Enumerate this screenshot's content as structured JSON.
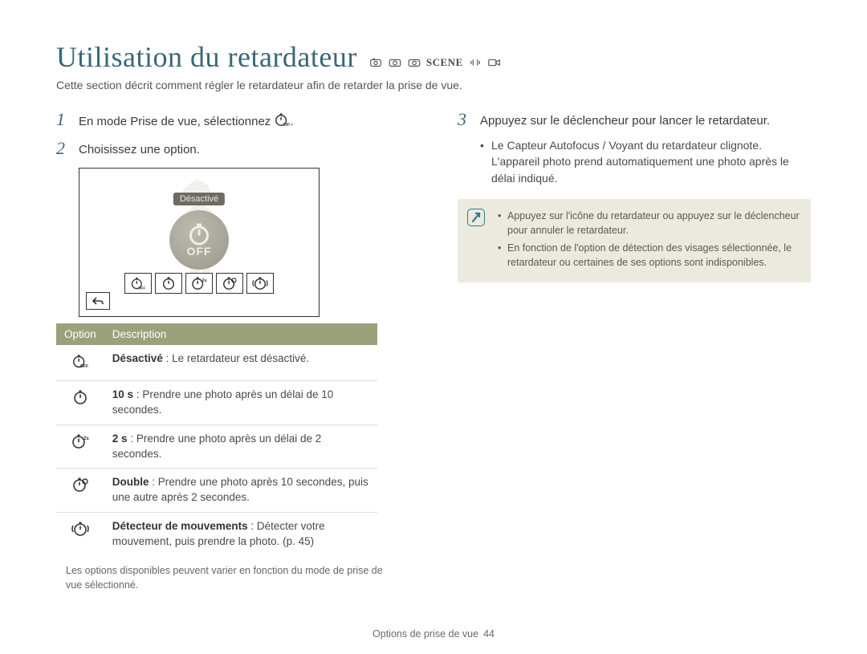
{
  "title": "Utilisation du retardateur",
  "intro": "Cette section décrit comment régler le retardateur afin de retarder la prise de vue.",
  "mode_icons": [
    "smart-auto-icon",
    "camera-icon",
    "camera-p-icon",
    "scene-text",
    "dual-is-icon",
    "movie-icon"
  ],
  "scene_label": "SCENE",
  "left": {
    "step1_pre": "En mode Prise de vue, sélectionnez ",
    "step1_icon": "timer-off-icon",
    "step1_post": ".",
    "step2": "Choisissez une option.",
    "figure": {
      "label": "Désactivé",
      "off_text": "OFF",
      "row_icons": [
        "timer-off-icon",
        "timer-10-icon",
        "timer-2-icon",
        "timer-double-icon",
        "timer-motion-icon"
      ],
      "back_icon": "back-icon"
    },
    "table": {
      "headers": {
        "option": "Option",
        "description": "Description"
      },
      "rows": [
        {
          "icon": "timer-off-icon",
          "label": "Désactivé",
          "desc": " : Le retardateur est désactivé."
        },
        {
          "icon": "timer-10-icon",
          "label": "10 s",
          "desc": " : Prendre une photo après un délai de 10 secondes."
        },
        {
          "icon": "timer-2-icon",
          "label": "2 s",
          "desc": " : Prendre une photo après un délai de 2 secondes."
        },
        {
          "icon": "timer-double-icon",
          "label": "Double",
          "desc": " : Prendre une photo après 10 secondes, puis une autre après 2 secondes."
        },
        {
          "icon": "timer-motion-icon",
          "label": "Détecteur de mouvements",
          "desc": " : Détecter votre mouvement, puis prendre la photo. (p. 45)"
        }
      ]
    },
    "footnote": "Les options disponibles peuvent varier en fonction du mode de prise de vue sélectionné."
  },
  "right": {
    "step3": "Appuyez sur le déclencheur pour lancer le retardateur.",
    "bullets": [
      "Le Capteur Autofocus / Voyant du retardateur clignote. L'appareil photo prend automatiquement une photo après le délai indiqué."
    ],
    "tips": [
      "Appuyez sur l'icône du retardateur ou appuyez sur le déclencheur pour annuler le retardateur.",
      "En fonction de l'option de détection des visages sélectionnée, le retardateur ou certaines de ses options sont indisponibles."
    ]
  },
  "footer": {
    "section": "Options de prise de vue",
    "page": "44"
  }
}
